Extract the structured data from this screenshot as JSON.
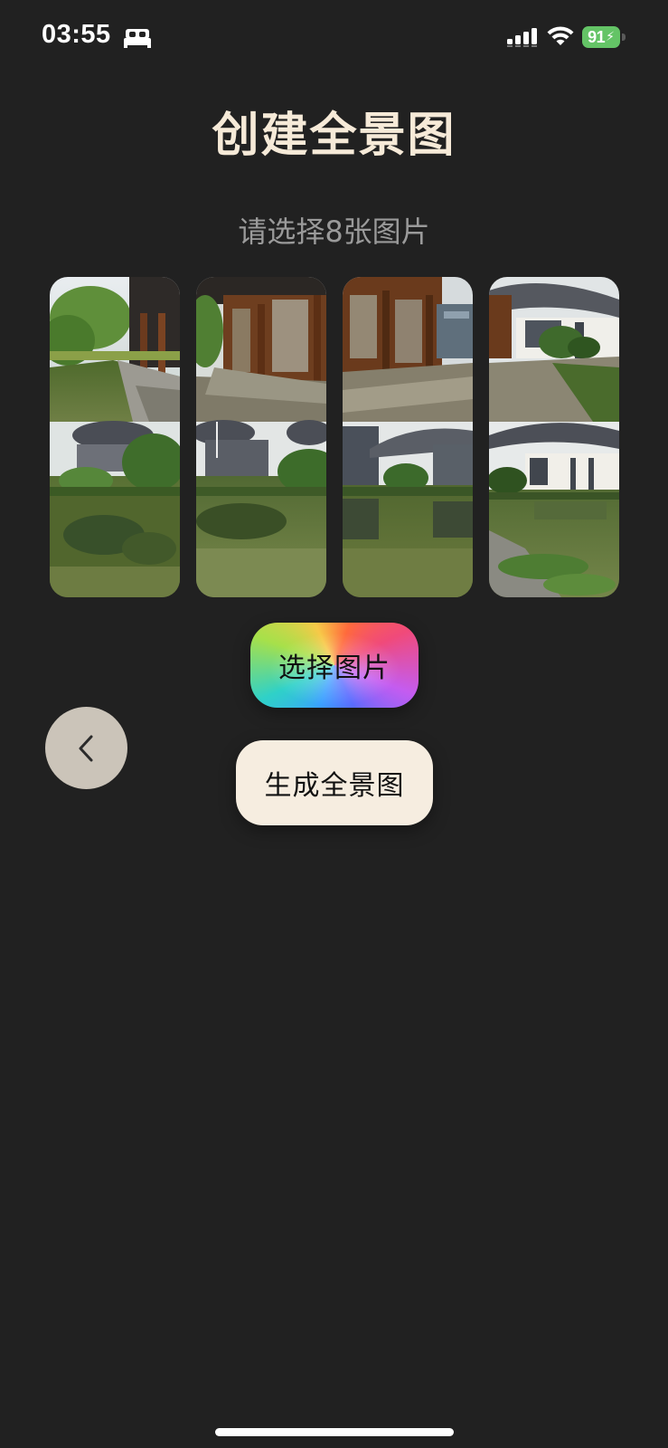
{
  "status_bar": {
    "time": "03:55",
    "battery_level": "91",
    "icons": [
      "sleep-focus-icon",
      "cellular-signal-icon",
      "wifi-icon",
      "battery-charging-icon"
    ]
  },
  "header": {
    "title": "创建全景图",
    "subtitle": "请选择8张图片"
  },
  "photos": {
    "count": 8,
    "items": [
      {
        "description": "photo-1"
      },
      {
        "description": "photo-2"
      },
      {
        "description": "photo-3"
      },
      {
        "description": "photo-4"
      },
      {
        "description": "photo-5"
      },
      {
        "description": "photo-6"
      },
      {
        "description": "photo-7"
      },
      {
        "description": "photo-8"
      }
    ]
  },
  "actions": {
    "select_label": "选择图片",
    "generate_label": "生成全景图",
    "back_icon": "chevron-left-icon"
  },
  "colors": {
    "background": "#212121",
    "title": "#f6ead8",
    "subtitle": "#9a9a9a",
    "generate_button": "#f6ede0",
    "back_button": "#cbc4b9",
    "battery": "#64c466"
  }
}
